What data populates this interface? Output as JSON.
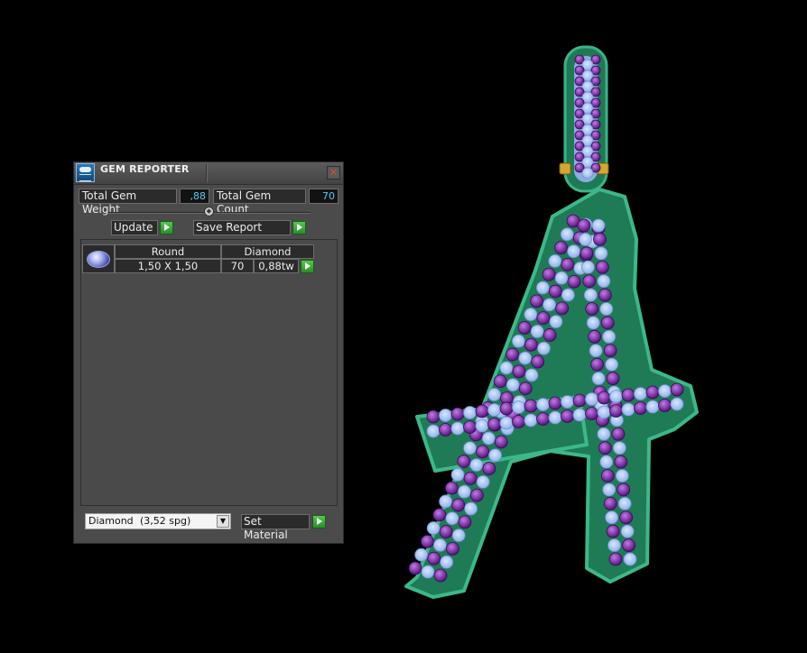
{
  "window": {
    "title": "GEM REPORTER",
    "close_glyph": "✕",
    "icon": "gem-reporter-icon"
  },
  "stats": {
    "weight_label": "Total Gem Weight",
    "weight_value": ",88",
    "count_label": "Total Gem Count",
    "count_value": "70"
  },
  "actions": {
    "update_label": "Update",
    "save_label": "Save Report",
    "set_material_label": "Set Material"
  },
  "gem_rows": [
    {
      "shape": "Round",
      "material": "Diamond",
      "size": "1,50 X 1,50",
      "count": "70",
      "weight": "0,88tw"
    }
  ],
  "material_select": {
    "name": "Diamond",
    "density": "(3,52 spg)"
  },
  "colors": {
    "panel_bg": "#4b4b4b",
    "value_text": "#59c9f6",
    "go_button": "#3fae3a",
    "metal_green": "#2e9a6e",
    "stone_light": "#a9c8f4",
    "stone_purple": "#7a2ca8",
    "bail_gold": "#d4a82e"
  }
}
